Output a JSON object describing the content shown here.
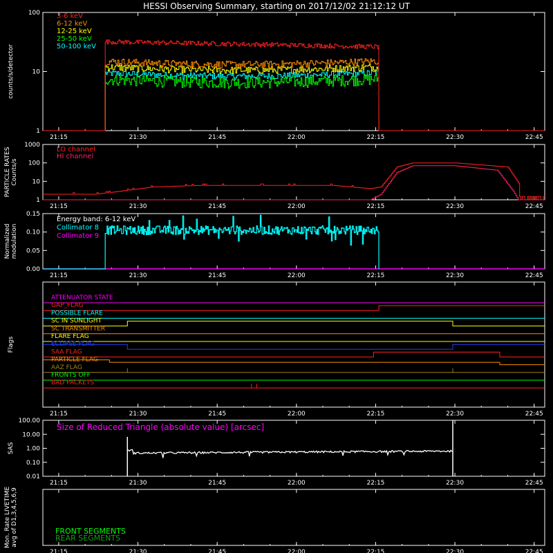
{
  "title": "HESSI Observing Summary, starting on 2017/12/02 21:12:12 UT",
  "colors": {
    "c36": "#ff2020",
    "c612": "#ff8c00",
    "c1225": "#ffff00",
    "c2550": "#00ff00",
    "c50100": "#00ffff",
    "lo": "#ff2020",
    "hi": "#ff2060",
    "col8": "#00ffff",
    "col9": "#ff00ff",
    "white": "#ffffff"
  },
  "time_ticks": [
    "21:15",
    "21:30",
    "21:45",
    "22:00",
    "22:15",
    "22:30",
    "22:45"
  ],
  "chart_data": [
    {
      "type": "line",
      "ylabel": "counts/s/detector",
      "yscale": "log",
      "ylim": [
        1,
        100
      ],
      "y_ticks": [
        "1",
        "10",
        "100"
      ],
      "y_tick_values": [
        1,
        10,
        100
      ],
      "xlim_min": [
        0,
        95
      ],
      "series": [
        {
          "name": "3-6 keV",
          "color_key": "c36",
          "t_start": 11.8,
          "t_end": 63.6,
          "level": 30,
          "noise": 0.09
        },
        {
          "name": "6-12 keV",
          "color_key": "c612",
          "t_start": 11.8,
          "t_end": 63.6,
          "level": 15,
          "noise": 0.14
        },
        {
          "name": "12-25 keV",
          "color_key": "c1225",
          "t_start": 11.8,
          "t_end": 63.6,
          "level": 12,
          "noise": 0.14
        },
        {
          "name": "25-50 keV",
          "color_key": "c2550",
          "t_start": 11.8,
          "t_end": 63.6,
          "level": 7.5,
          "noise": 0.22
        },
        {
          "name": "50-100 keV",
          "color_key": "c50100",
          "t_start": 11.8,
          "t_end": 63.6,
          "level": 9.5,
          "noise": 0.13
        }
      ]
    },
    {
      "type": "line",
      "ylabel": "PARTICLE RATES\nCounts/s",
      "yscale": "log",
      "ylim": [
        1,
        1000
      ],
      "y_ticks": [
        "1",
        "10",
        "100",
        "1000"
      ],
      "y_tick_values": [
        1,
        10,
        100,
        1000
      ],
      "series": [
        {
          "name": "LO channel",
          "color_key": "lo"
        },
        {
          "name": "HI channel",
          "color_key": "hi"
        }
      ],
      "lo_profile": [
        [
          0,
          2
        ],
        [
          10,
          2
        ],
        [
          15,
          3
        ],
        [
          21,
          5
        ],
        [
          30,
          6
        ],
        [
          55,
          6
        ],
        [
          62,
          4
        ],
        [
          64,
          5
        ],
        [
          67,
          60
        ],
        [
          70,
          100
        ],
        [
          78,
          100
        ],
        [
          88,
          60
        ],
        [
          91,
          3
        ],
        [
          95,
          1.5
        ]
      ],
      "hi_profile": [
        [
          0,
          1
        ],
        [
          62,
          1
        ],
        [
          64,
          2
        ],
        [
          67,
          30
        ],
        [
          70,
          70
        ],
        [
          78,
          70
        ],
        [
          86,
          40
        ],
        [
          89,
          3
        ],
        [
          90,
          1
        ],
        [
          95,
          1
        ]
      ]
    },
    {
      "type": "line",
      "ylabel": "Normalized\nmodulation",
      "ylim": [
        0,
        0.15
      ],
      "y_ticks": [
        "0.00",
        "0.05",
        "0.10",
        "0.15"
      ],
      "y_tick_values": [
        0,
        0.05,
        0.1,
        0.15
      ],
      "energy_band": "Energy band: 6-12 keV",
      "series": [
        {
          "name": "Collimator 8",
          "color_key": "col8",
          "t_start": 11.8,
          "t_end": 63.6,
          "level": 0.105,
          "noise": 0.012
        },
        {
          "name": "Collimator 9",
          "color_key": "col9",
          "level": 0
        }
      ]
    },
    {
      "type": "table",
      "ylabel": "Flags",
      "flags": [
        {
          "name": "ATTENUATOR STATE",
          "color": "#ff00ff",
          "steps": [
            [
              0,
              0
            ]
          ]
        },
        {
          "name": "GAP_FLAG",
          "color": "#ff2020",
          "steps": [
            [
              0,
              0
            ],
            [
              63.6,
              1
            ]
          ]
        },
        {
          "name": "POSSIBLE FLARE",
          "color": "#00ffff",
          "steps": [
            [
              0,
              0
            ]
          ]
        },
        {
          "name": "SC IN SUNLIGHT",
          "color": "#ffff00",
          "steps": [
            [
              0,
              0
            ],
            [
              16,
              1
            ],
            [
              77.6,
              0
            ]
          ]
        },
        {
          "name": "SC TRANSMITTER",
          "color": "#ff8c00",
          "steps": [
            [
              0,
              0
            ]
          ]
        },
        {
          "name": "FLARE FLAG",
          "color": "#ffff00",
          "steps": [
            [
              0,
              0
            ]
          ]
        },
        {
          "name": "ECLIPSE FLAG",
          "color": "#2040ff",
          "steps": [
            [
              0,
              1
            ],
            [
              16,
              0
            ],
            [
              77.6,
              1
            ]
          ]
        },
        {
          "name": "SAA FLAG",
          "color": "#ff2020",
          "steps": [
            [
              0,
              0
            ],
            [
              62.6,
              1
            ],
            [
              86.5,
              0
            ]
          ]
        },
        {
          "name": "PARTICLE FLAG",
          "color": "#ff8c00",
          "steps": [
            [
              0,
              1
            ],
            [
              12.6,
              0.5
            ],
            [
              86.5,
              0
            ]
          ]
        },
        {
          "name": "AAZ FLAG",
          "color": "#a08020",
          "steps": [
            [
              0,
              0
            ]
          ],
          "spikes": [
            16,
            77.6
          ]
        },
        {
          "name": "FRONTS OFF",
          "color": "#00ff00",
          "steps": [
            [
              0,
              0
            ]
          ]
        },
        {
          "name": "BAD PACKETS",
          "color": "#ff2020",
          "steps": [
            [
              0,
              0
            ]
          ],
          "spikes": [
            39.5,
            40.5
          ]
        }
      ]
    },
    {
      "type": "line",
      "ylabel": "SAS",
      "yscale": "log",
      "ylim": [
        0.01,
        100
      ],
      "y_ticks": [
        "0.01",
        "0.10",
        "1.00",
        "10.00",
        "100.00"
      ],
      "y_tick_values": [
        0.01,
        0.1,
        1,
        10,
        100
      ],
      "annotation": "Size of Reduced Triangle (absolute value) [arcsec]",
      "series": [
        {
          "name": "SAS",
          "color_key": "white",
          "t_start": 16,
          "t_end": 77.6,
          "level": 0.45
        }
      ]
    },
    {
      "type": "line",
      "ylabel": "Mon. Rate LIVETIME\navg of D1,3,4,5,6,9",
      "series": [
        {
          "name": "FRONT SEGMENTS",
          "color": "#00ff00"
        },
        {
          "name": "REAR SEGMENTS",
          "color": "#10a010"
        }
      ]
    }
  ]
}
